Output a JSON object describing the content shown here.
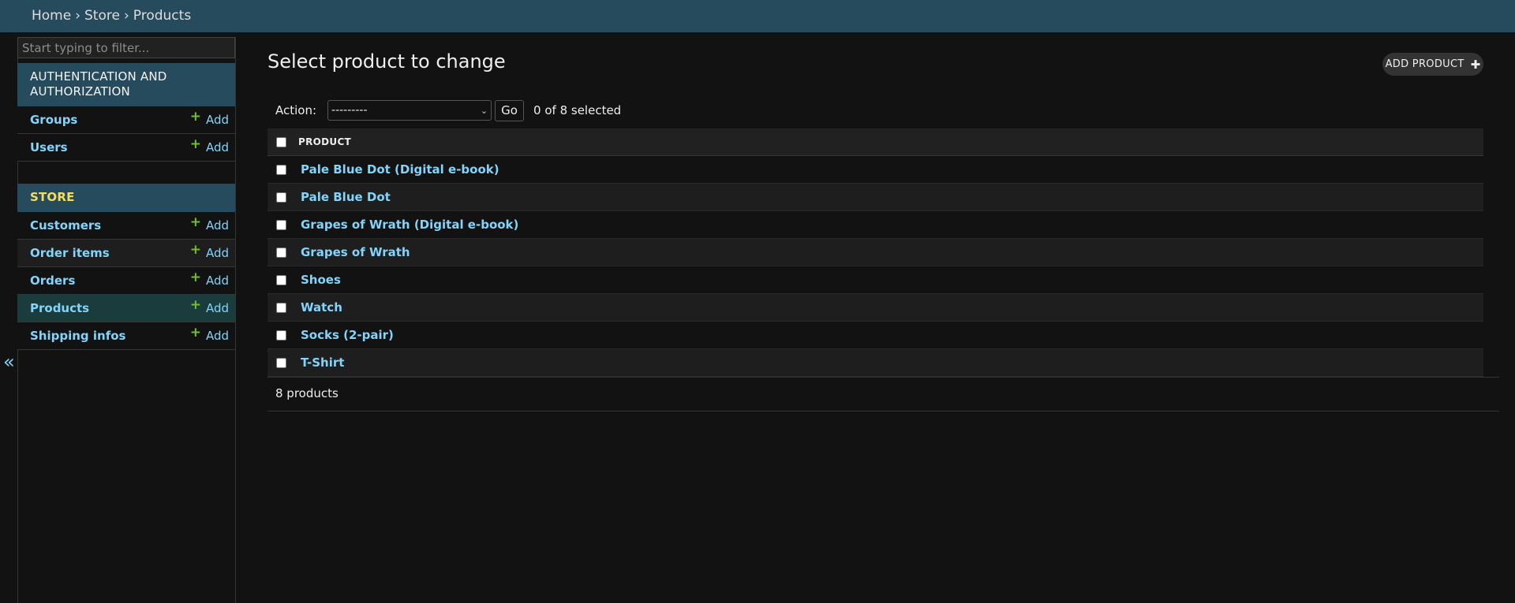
{
  "breadcrumbs": {
    "home": "Home",
    "separator1": "›",
    "store": "Store",
    "separator2": "›",
    "current": "Products"
  },
  "sidebar": {
    "filter_placeholder": "Start typing to filter...",
    "collapse_glyph": "«",
    "auth_module": {
      "caption": "AUTHENTICATION AND AUTHORIZATION",
      "models": [
        {
          "label": "Groups",
          "add": "Add"
        },
        {
          "label": "Users",
          "add": "Add"
        }
      ]
    },
    "store_module": {
      "caption": "STORE",
      "models": [
        {
          "label": "Customers",
          "add": "Add"
        },
        {
          "label": "Order items",
          "add": "Add"
        },
        {
          "label": "Orders",
          "add": "Add"
        },
        {
          "label": "Products",
          "add": "Add",
          "selected": true
        },
        {
          "label": "Shipping infos",
          "add": "Add"
        }
      ]
    },
    "plus_glyph": "+"
  },
  "main": {
    "title": "Select product to change",
    "add_button": "ADD PRODUCT",
    "add_button_glyph": "✚",
    "actions": {
      "label": "Action:",
      "selected_option": "---------",
      "go": "Go",
      "counter": "0 of 8 selected"
    },
    "table": {
      "column_header": "PRODUCT",
      "rows": [
        "Pale Blue Dot (Digital e-book)",
        "Pale Blue Dot",
        "Grapes of Wrath (Digital e-book)",
        "Grapes of Wrath",
        "Shoes",
        "Watch",
        "Socks (2-pair)",
        "T-Shirt"
      ]
    },
    "paginator": "8 products"
  },
  "colors": {
    "header_bg": "#264b5d",
    "link": "#81d4fa",
    "add_plus": "#70bf2b",
    "selected_row": "#1a3c3c",
    "page_bg": "#121212"
  }
}
